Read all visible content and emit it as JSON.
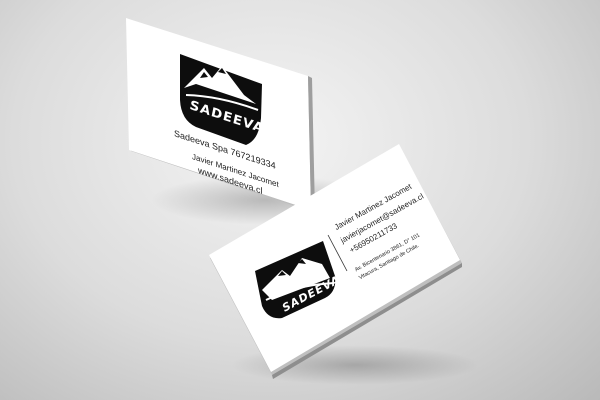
{
  "back_card": {
    "logo_text": "SADEEVA",
    "company_line": "Sadeeva Spa 767219334",
    "name": "Javier Martinez Jacomet",
    "website": "www.sadeeva.cl"
  },
  "front_card": {
    "logo_text": "SADEEVA",
    "name": "Javier Martinez Jacomet",
    "email": "javierjacomet@sadeeva.cl",
    "phone": "+56950211733",
    "address_line1": "Av. Bicentenario 3861, D° 101",
    "address_line2": "Vitacura, Santiago de Chile."
  },
  "colors": {
    "card": "#ffffff",
    "ink": "#111111",
    "background": "#d6d6d6"
  }
}
